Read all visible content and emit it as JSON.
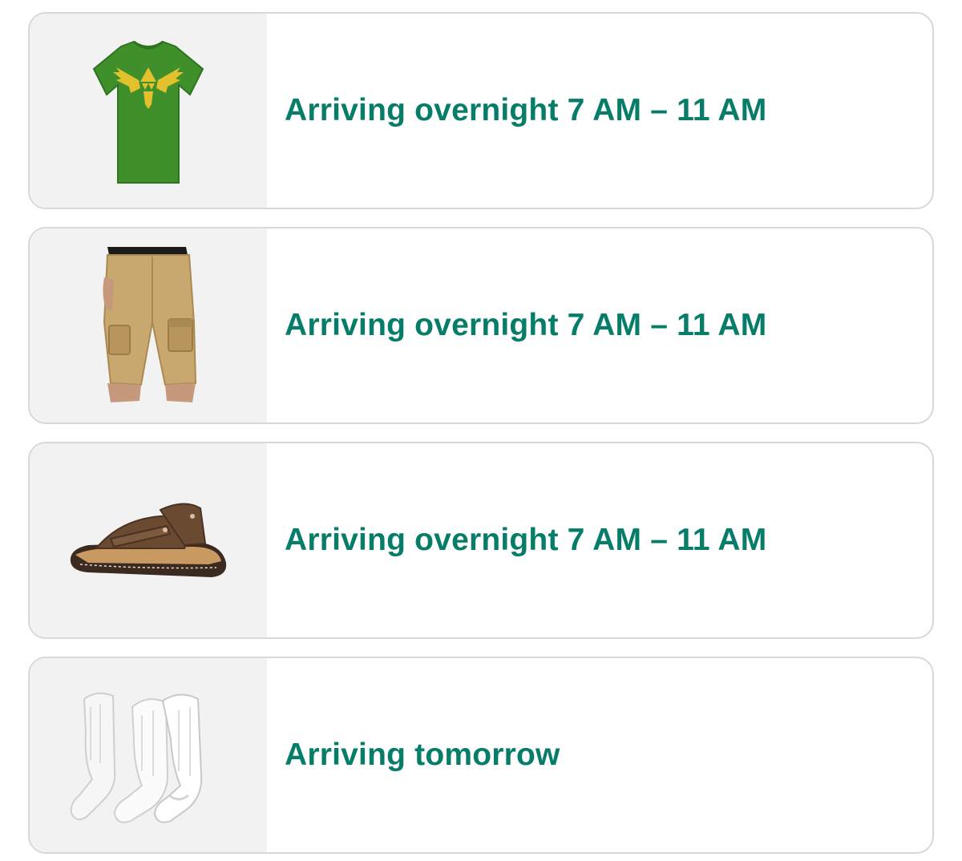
{
  "theme": {
    "status_color": "#067d68",
    "card_border": "#d5d9d9",
    "thumb_bg": "#f2f2f2"
  },
  "orders": [
    {
      "item_icon": "t-shirt-icon",
      "status": "Arriving overnight 7 AM – 11 AM"
    },
    {
      "item_icon": "cargo-shorts-icon",
      "status": "Arriving overnight 7 AM – 11 AM"
    },
    {
      "item_icon": "sandal-icon",
      "status": "Arriving overnight 7 AM – 11 AM"
    },
    {
      "item_icon": "socks-icon",
      "status": "Arriving tomorrow"
    }
  ]
}
